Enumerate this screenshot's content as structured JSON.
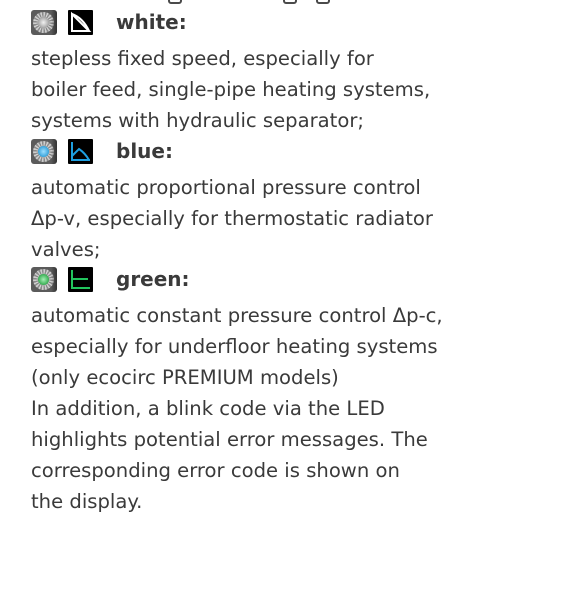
{
  "modes": [
    {
      "label": "white:",
      "led_icon": "pump-led-white-icon",
      "curve_icon": "stepless-fixed-speed-curve-icon",
      "led_color": "#b9b9b9",
      "curve_color": "#ffffff",
      "description_lines": [
        "stepless fixed speed, especially for",
        "boiler feed, single-pipe heating systems,",
        "systems with hydraulic separator;"
      ]
    },
    {
      "label": "blue:",
      "led_icon": "pump-led-blue-icon",
      "curve_icon": "proportional-pressure-curve-icon",
      "led_color": "#2f9ed8",
      "curve_color": "#1e9fe0",
      "description_lines": [
        "automatic proportional pressure control",
        "Δp-v, especially for thermostatic radiator",
        "valves;"
      ]
    },
    {
      "label": "green:",
      "led_icon": "pump-led-green-icon",
      "curve_icon": "constant-pressure-curve-icon",
      "led_color": "#2fa84a",
      "curve_color": "#22c55e",
      "description_lines": [
        "automatic constant pressure control Δp-c,",
        "especially for underfloor heating systems",
        "(only ecocirc PREMIUM models)"
      ]
    }
  ],
  "blink_note_lines": [
    "In addition, a blink code via the LED",
    "highlights potential error messages. The",
    "corresponding error code is shown on",
    "the display."
  ]
}
